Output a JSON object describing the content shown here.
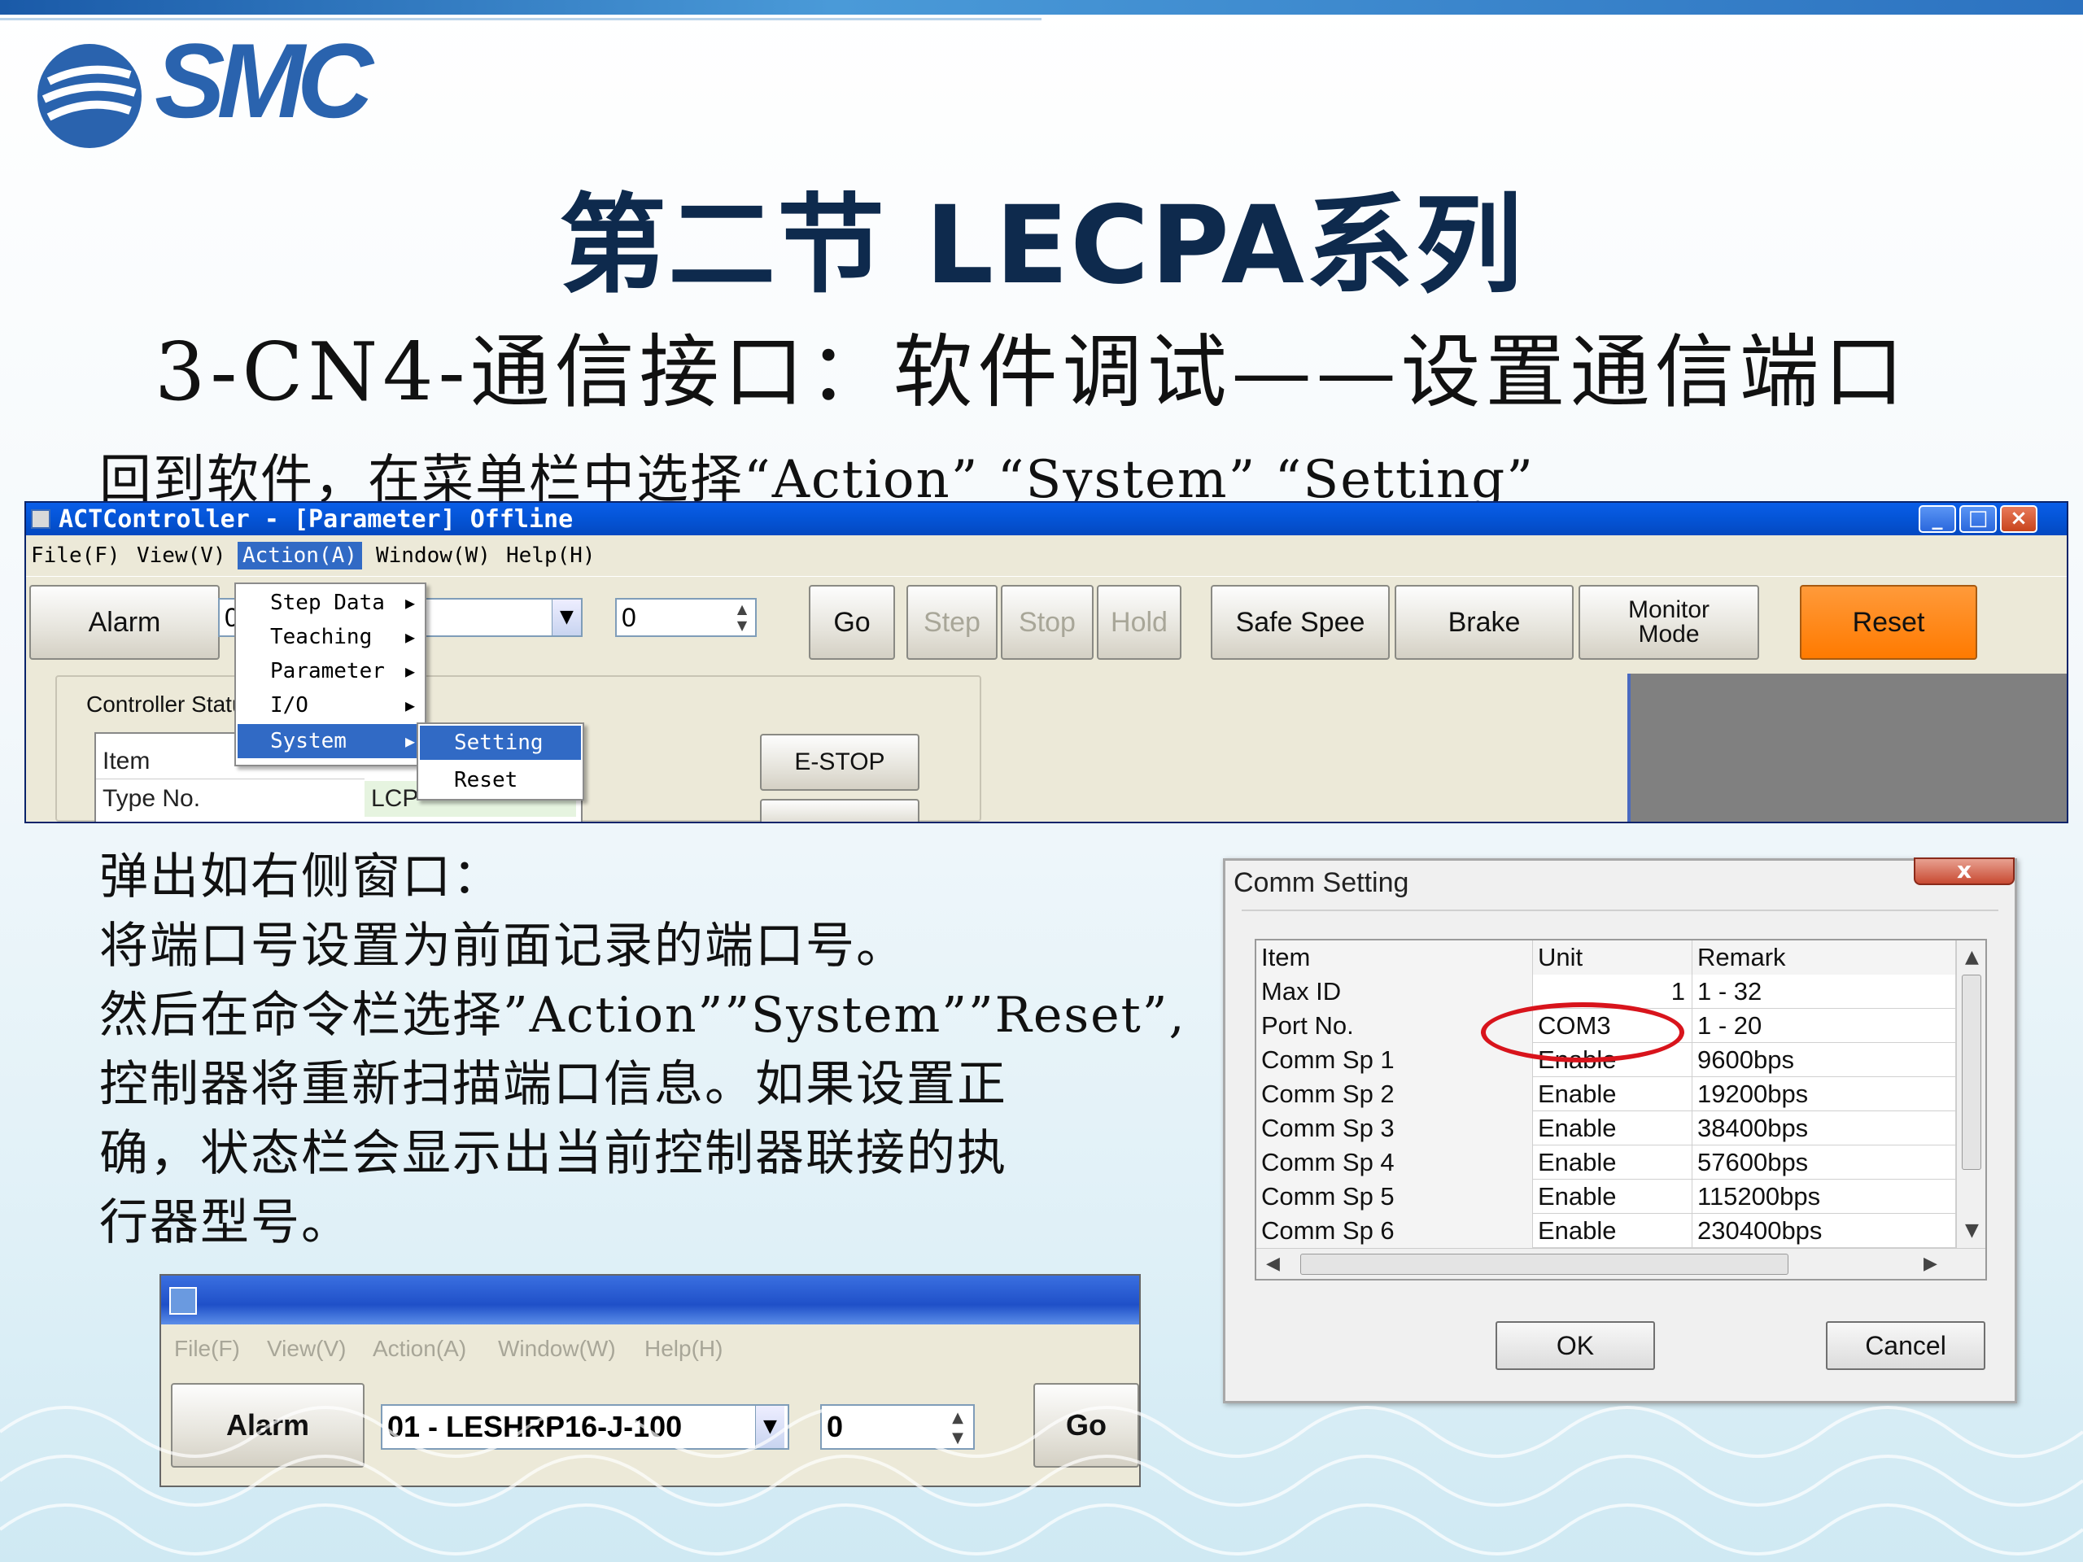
{
  "slide": {
    "logo": "SMC",
    "title": "第二节  LECPA系列",
    "subtitle": "3-CN4-通信接口：软件调试——设置通信端口",
    "instruction": "回到软件，在菜单栏中选择“Action” “System” “Setting”",
    "body_lines": [
      "弹出如右侧窗口：",
      "将端口号设置为前面记录的端口号。",
      "然后在命令栏选择”Action””System””Reset”,",
      "控制器将重新扫描端口信息。如果设置正",
      "确，状态栏会显示出当前控制器联接的执",
      "行器型号。"
    ]
  },
  "app_window": {
    "title": "ACTController - [Parameter] Offline",
    "menu": [
      "File(F)",
      "View(V)",
      "Action(A)",
      "Window(W)",
      "Help(H)"
    ],
    "toolbar": {
      "alarm": "Alarm",
      "combo_value": "0",
      "spin_value": "0",
      "go": "Go",
      "step": "Step",
      "stop": "Stop",
      "hold": "Hold",
      "safe_speed": "Safe Spee",
      "brake": "Brake",
      "monitor_mode_1": "Monitor",
      "monitor_mode_2": "Mode",
      "reset": "Reset"
    },
    "status": {
      "legend": "Controller Status",
      "col_item": "Item",
      "row1_item": "Type No.",
      "row1_value": "LCP",
      "estop": "E-STOP"
    },
    "action_menu": [
      "Step Data",
      "Teaching",
      "Parameter",
      "I/O",
      "System"
    ],
    "system_submenu": [
      "Setting",
      "Reset"
    ]
  },
  "comm_dialog": {
    "title": "Comm Setting",
    "close": "x",
    "headers": [
      "Item",
      "Unit",
      "Remark"
    ],
    "rows": [
      {
        "item": "Max ID",
        "unit": "1",
        "remark": "1 - 32"
      },
      {
        "item": "Port No.",
        "unit": "COM3",
        "remark": "1 - 20"
      },
      {
        "item": "Comm Sp 1",
        "unit": "Enable",
        "remark": "9600bps"
      },
      {
        "item": "Comm Sp 2",
        "unit": "Enable",
        "remark": "19200bps"
      },
      {
        "item": "Comm Sp 3",
        "unit": "Enable",
        "remark": "38400bps"
      },
      {
        "item": "Comm Sp 4",
        "unit": "Enable",
        "remark": "57600bps"
      },
      {
        "item": "Comm Sp 5",
        "unit": "Enable",
        "remark": "115200bps"
      },
      {
        "item": "Comm Sp 6",
        "unit": "Enable",
        "remark": "230400bps"
      }
    ],
    "ok": "OK",
    "cancel": "Cancel"
  },
  "app_window2": {
    "menu": [
      "File(F)",
      "View(V)",
      "Action(A)",
      "Window(W)",
      "Help(H)"
    ],
    "alarm": "Alarm",
    "combo_value": "01 - LESHRP16-J-100",
    "spin_value": "0",
    "go": "Go"
  },
  "colors": {
    "title_text": "#0e2a4d",
    "xp_titlebar": "#0454d6",
    "menu_highlight": "#316ac5",
    "reset_button": "#ff7a00",
    "highlight_ellipse": "#d8141c"
  }
}
